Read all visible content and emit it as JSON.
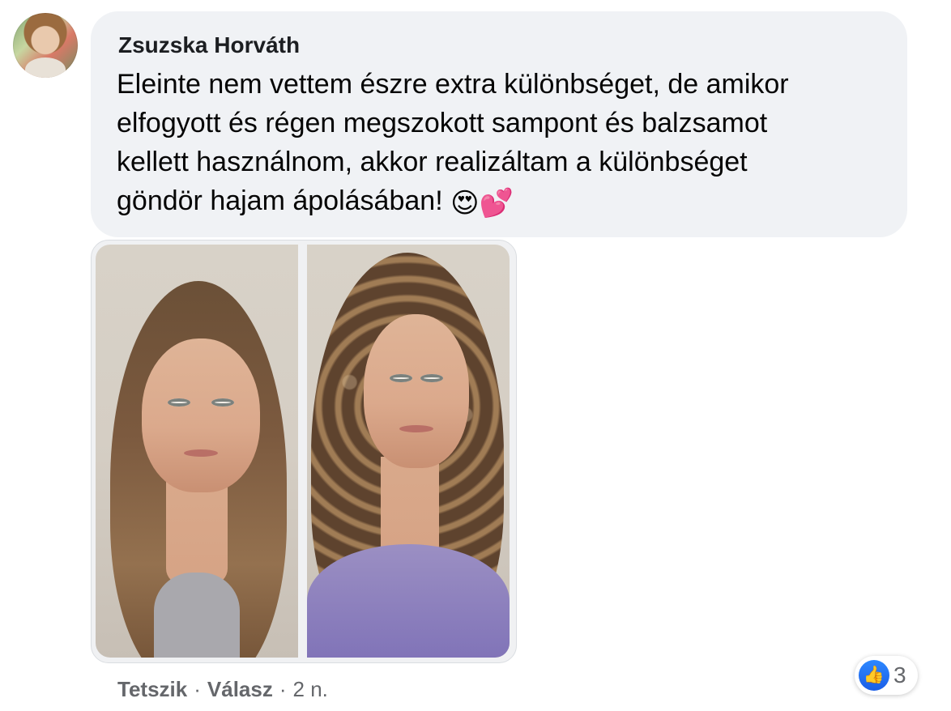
{
  "comment": {
    "author": "Zsuzska Horváth",
    "text": "Eleinte nem vettem észre extra különbséget, de amikor\nelfogyott és régen megszokott sampont és balzsamot\nkellett használnom, akkor realizáltam a különbséget\ngöndör hajam ápolásában!",
    "emojis": "😍💕",
    "avatar_icon": "profile-photo",
    "attachment_icons": [
      "photo-before",
      "photo-after"
    ]
  },
  "actions": {
    "like_label": "Tetszik",
    "separator_1": "·",
    "reply_label": "Válasz",
    "separator_2": "·",
    "time": "2 n."
  },
  "reactions": {
    "icon": "like-icon",
    "icon_glyph": "👍",
    "count": "3",
    "accent_color": "#1877f2"
  }
}
